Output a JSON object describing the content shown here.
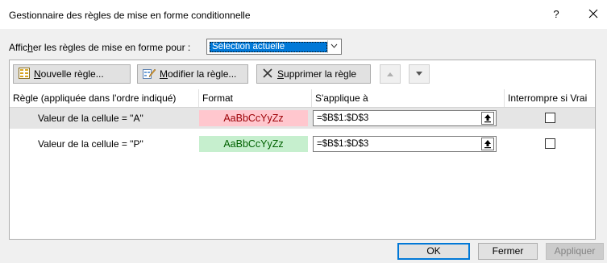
{
  "window": {
    "title": "Gestionnaire des règles de mise en forme conditionnelle",
    "help_label": "?"
  },
  "show_rules": {
    "label_pre": "Affic",
    "label_key": "h",
    "label_post": "er les règles de mise en forme pour :",
    "selected_value": "Sélection actuelle"
  },
  "toolbar": {
    "new_rule": {
      "key": "N",
      "rest": "ouvelle règle..."
    },
    "edit_rule": {
      "key": "M",
      "rest": "odifier la règle..."
    },
    "delete_rule": {
      "key": "S",
      "rest": "upprimer la règle"
    }
  },
  "table": {
    "headers": {
      "rule": "Règle (appliquée dans l'ordre indiqué)",
      "format": "Format",
      "applies_to": "S'applique à",
      "stop_if_true": "Interrompre si Vrai"
    },
    "rows": [
      {
        "rule": "Valeur de la cellule = \"A\"",
        "format_preview": "AaBbCcYyZz",
        "applies_to": "=$B$1:$D$3",
        "stop_if_true": false,
        "selected": true
      },
      {
        "rule": "Valeur de la cellule = \"P\"",
        "format_preview": "AaBbCcYyZz",
        "applies_to": "=$B$1:$D$3",
        "stop_if_true": false,
        "selected": false
      }
    ]
  },
  "colors": {
    "row1_fill": "#ffc7ce",
    "row1_font": "#9c0006",
    "row2_fill": "#c6efce",
    "row2_font": "#006100",
    "selection_blue": "#0078d7"
  },
  "buttons": {
    "ok": "OK",
    "close": "Fermer",
    "apply": "Appliquer"
  }
}
